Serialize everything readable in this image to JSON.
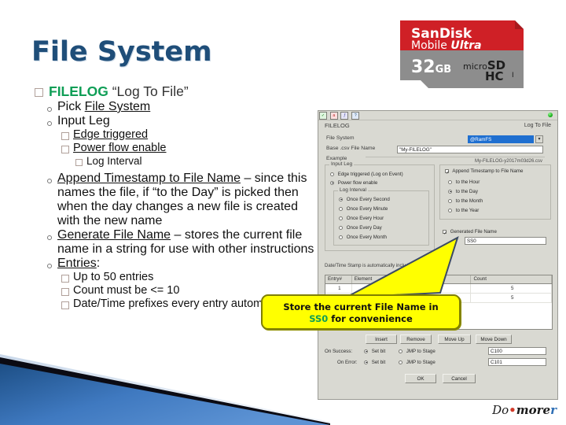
{
  "slide": {
    "title": "File System",
    "logo": {
      "pre": "Do",
      "sep": "•",
      "more": "more",
      "tail": "r"
    }
  },
  "outline": {
    "l1": {
      "green": "FILELOG",
      "quoted": "“Log To File”"
    },
    "items": [
      {
        "level": 2,
        "text": "Pick File System",
        "underline_part": "File System"
      },
      {
        "level": 2,
        "text": "Input Leg",
        "underline_part": ""
      },
      {
        "level": 3,
        "text": "Edge triggered",
        "underline_part": "Edge triggered"
      },
      {
        "level": 3,
        "text": "Power flow enable",
        "underline_part": "Power flow enable"
      },
      {
        "level": 4,
        "text": "Log Interval",
        "underline_part": ""
      },
      {
        "level": 2,
        "text": "Append Timestamp to File Name – since this names the file, if “to the Day” is picked then when the day changes a new file is created with the new name",
        "underline_part": "Append Timestamp to File Name"
      },
      {
        "level": 2,
        "text": "Generate File Name – stores the current file name in a string for use with other instructions",
        "underline_part": "Generate File Name"
      },
      {
        "level": 2,
        "text": "Entries:",
        "underline_part": "Entries"
      },
      {
        "level": 3,
        "text": "Up to 50 entries",
        "underline_part": ""
      },
      {
        "level": 3,
        "text": "Count must be <= 10",
        "underline_part": ""
      },
      {
        "level": 3,
        "text": "Date/Time prefixes every entry automatically",
        "underline_part": ""
      }
    ]
  },
  "callout": {
    "line1_a": "Store the current File Name in",
    "line2_ss0": "SS0",
    "line2_b": "for convenience"
  },
  "sdcard": {
    "brand": "SanDisk",
    "line2_a": "Mobile",
    "line2_b": "Ultra",
    "capacity": "32",
    "capacity_unit": "GB",
    "format_micro": "micro",
    "format_sd": "SD",
    "format_hc": "HC",
    "format_i": "I"
  },
  "dialog": {
    "toolbar_icons": [
      "check-icon",
      "abc-icon",
      "fx-icon",
      "help-icon"
    ],
    "led_name": "status-led",
    "instruction": "FILELOG",
    "instruction_desc": "Log To File",
    "file_system_label": "File System",
    "file_system_value": "@RamFS",
    "base_name_label": "Base .csv File Name",
    "base_name_value": "\"My-FILELOG\"",
    "example_label": "Example",
    "example_value": "My-FILELOG-y2017m03d26.csv",
    "input_leg_group": "Input Leg",
    "input_leg_options": [
      {
        "label": "Edge triggered (Log on Event)",
        "selected": false
      },
      {
        "label": "Power flow enable",
        "selected": true
      }
    ],
    "log_interval_group": "Log Interval",
    "log_interval_options": [
      {
        "label": "Once Every Second",
        "selected": true
      },
      {
        "label": "Once Every Minute",
        "selected": false
      },
      {
        "label": "Once Every Hour",
        "selected": false
      },
      {
        "label": "Once Every Day",
        "selected": false
      },
      {
        "label": "Once Every Month",
        "selected": false
      }
    ],
    "append_timestamp_label": "Append Timestamp to File Name",
    "append_timestamp_checked": true,
    "timestamp_options": [
      {
        "label": "to the Hour",
        "selected": false
      },
      {
        "label": "to the Day",
        "selected": true
      },
      {
        "label": "to the Month",
        "selected": false
      },
      {
        "label": "to the Year",
        "selected": false
      }
    ],
    "generated_name_label": "Generated File Name",
    "generated_name_checked": true,
    "generated_name_value": "SS0",
    "datetime_note": "Date/Time Stamp is automatically included in log entry",
    "table": {
      "columns": [
        "Entry#",
        "Element",
        "Count"
      ],
      "rows": [
        {
          "entry": "1",
          "element": "",
          "count": "5"
        },
        {
          "entry": "",
          "element": "",
          "count": "5"
        }
      ]
    },
    "list_buttons": [
      "Insert",
      "Remove",
      "Move Up",
      "Move Down"
    ],
    "on_success_label": "On Success:",
    "on_error_label": "On Error:",
    "set_bit_label": "Set bit",
    "jmp_stage_label": "JMP to Stage",
    "on_success_value": "C100",
    "on_error_value": "C101",
    "ok_label": "OK",
    "cancel_label": "Cancel"
  },
  "colors": {
    "title_blue": "#1f4e79",
    "accent_green": "#0f9e56",
    "callout_yellow": "#ffff00",
    "band_blue": "#2f6fb5"
  }
}
